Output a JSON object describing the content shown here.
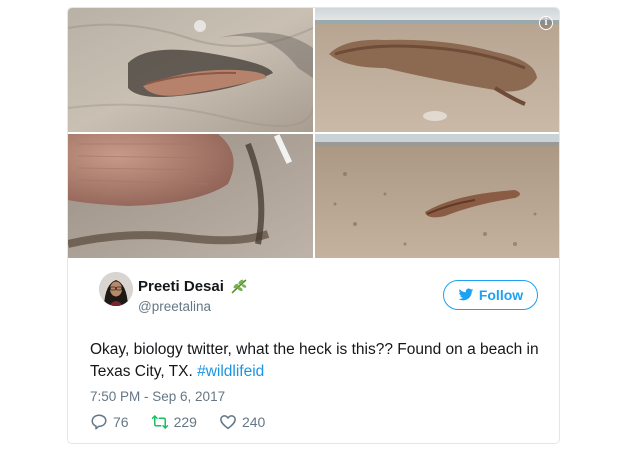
{
  "media": {
    "photos": [
      {
        "name": "photo-1",
        "desc": ""
      },
      {
        "name": "photo-2",
        "desc": ""
      },
      {
        "name": "photo-3",
        "desc": ""
      },
      {
        "name": "photo-4",
        "desc": ""
      }
    ],
    "info_icon_glyph": "i"
  },
  "author": {
    "display_name": "Preeti Desai",
    "handle": "@preetalina",
    "name_emoji_icon": "herb-icon"
  },
  "follow_button": {
    "label": "Follow",
    "icon": "twitter-bird-icon"
  },
  "tweet": {
    "text_before_hashtag": "Okay, biology twitter, what the heck is this?? Found on a beach in Texas City, TX. ",
    "hashtag": "#wildlifeid",
    "timestamp": "7:50 PM - Sep 6, 2017"
  },
  "actions": {
    "replies": "76",
    "retweets": "229",
    "likes": "240"
  },
  "colors": {
    "accent": "#1da1f2",
    "hashtag": "#1b95e0",
    "muted": "#657786",
    "text": "#14171a"
  }
}
